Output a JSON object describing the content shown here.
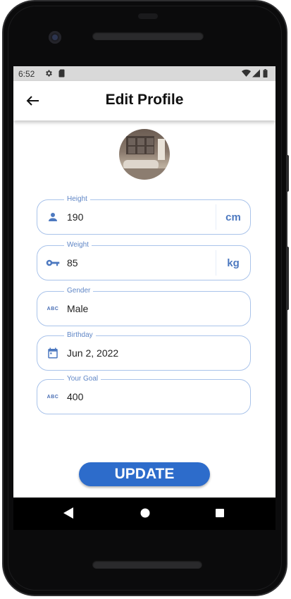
{
  "status_bar": {
    "time": "6:52"
  },
  "app_bar": {
    "title": "Edit Profile"
  },
  "fields": [
    {
      "label": "Height",
      "value": "190",
      "suffix": "cm",
      "icon": "person-icon"
    },
    {
      "label": "Weight",
      "value": "85",
      "suffix": "kg",
      "icon": "key-icon"
    },
    {
      "label": "Gender",
      "value": "Male",
      "icon": "abc-icon",
      "icon_text": "ABC"
    },
    {
      "label": "Birthday",
      "value": "Jun 2, 2022",
      "icon": "calendar-icon"
    },
    {
      "label": "Your Goal",
      "value": "400",
      "icon": "abc-icon",
      "icon_text": "ABC"
    }
  ],
  "update_button": {
    "label": "UPDATE"
  },
  "colors": {
    "accent": "#2d6ccb",
    "field_border": "#a9c3ea",
    "label": "#5f86c6"
  }
}
